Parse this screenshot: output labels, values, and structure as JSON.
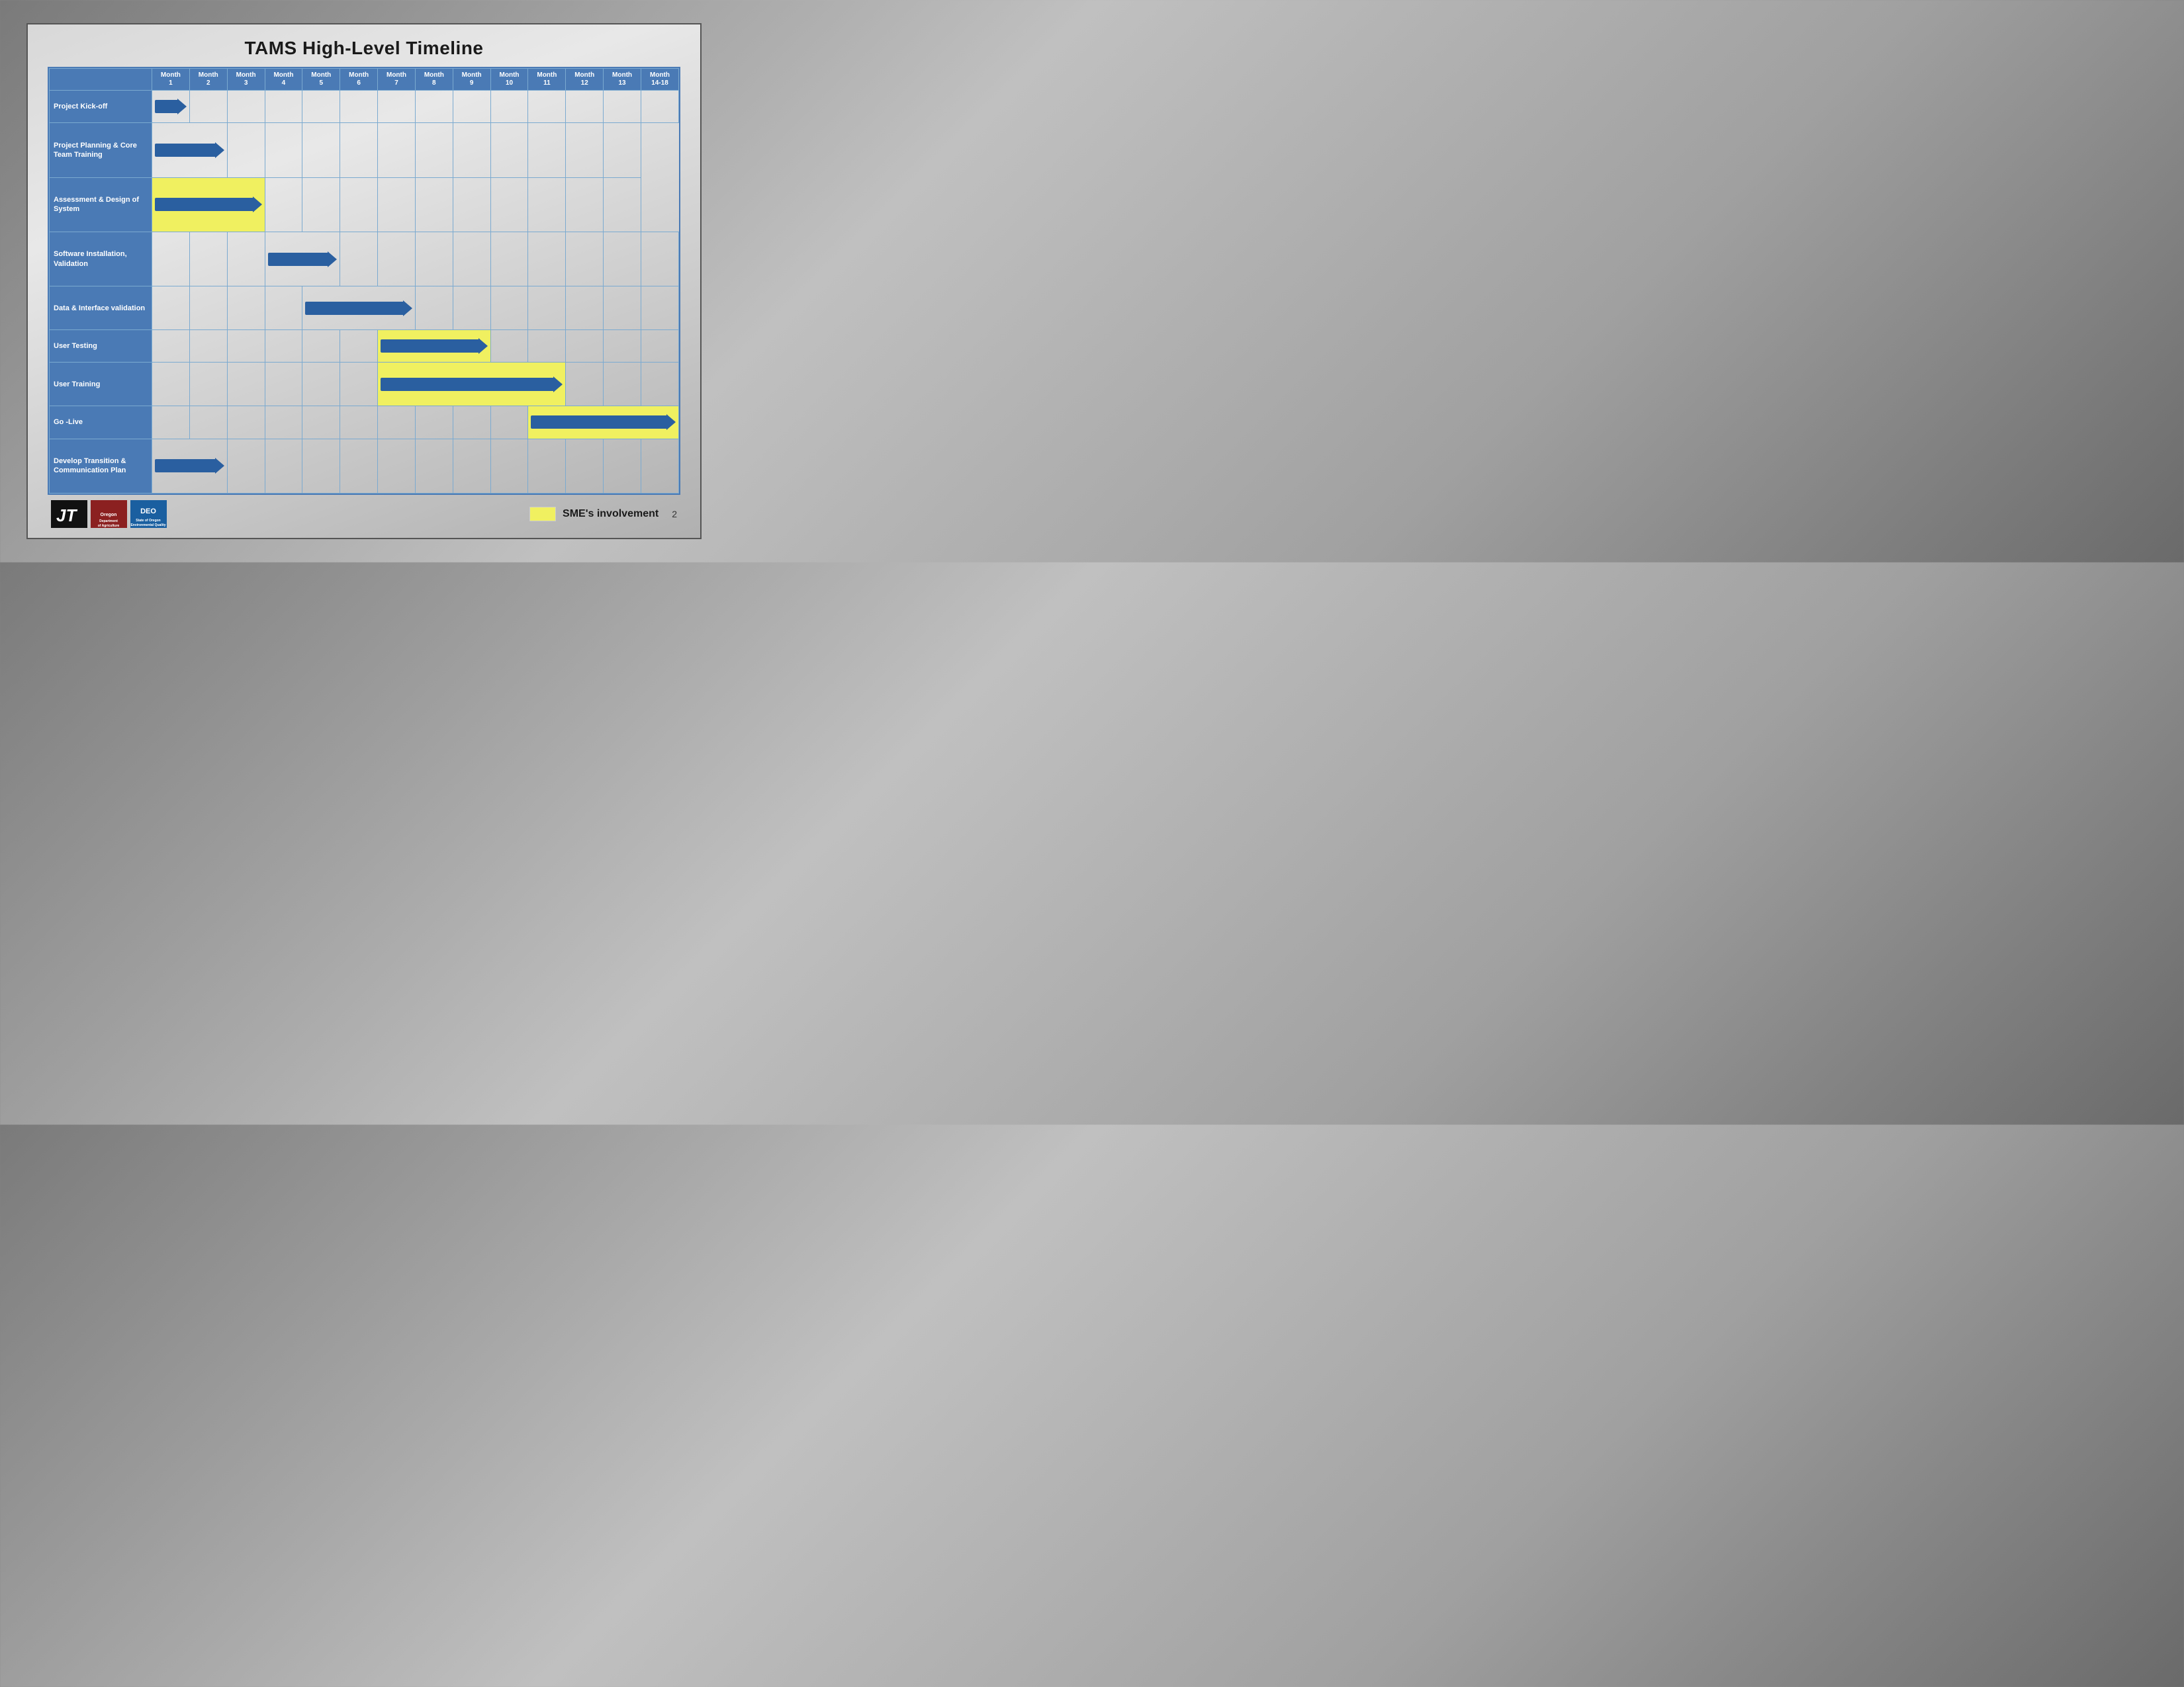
{
  "title": "TAMS High-Level Timeline",
  "months": [
    {
      "label": "Month",
      "sub": "1"
    },
    {
      "label": "Month",
      "sub": "2"
    },
    {
      "label": "Month",
      "sub": "3"
    },
    {
      "label": "Month",
      "sub": "4"
    },
    {
      "label": "Month",
      "sub": "5"
    },
    {
      "label": "Month",
      "sub": "6"
    },
    {
      "label": "Month",
      "sub": "7"
    },
    {
      "label": "Month",
      "sub": "8"
    },
    {
      "label": "Month",
      "sub": "9"
    },
    {
      "label": "Month",
      "sub": "10"
    },
    {
      "label": "Month",
      "sub": "11"
    },
    {
      "label": "Month",
      "sub": "12"
    },
    {
      "label": "Month",
      "sub": "13"
    },
    {
      "label": "Month",
      "sub": "14-18"
    }
  ],
  "tasks": [
    {
      "name": "Project Kick-off",
      "arrow_start": 1,
      "arrow_end": 1,
      "yellow": false
    },
    {
      "name": "Project Planning & Core Team Training",
      "arrow_start": 1,
      "arrow_end": 2,
      "yellow": false
    },
    {
      "name": "Assessment & Design of System",
      "arrow_start": 1,
      "arrow_end": 3,
      "yellow": true
    },
    {
      "name": "Software Installation, Validation",
      "arrow_start": 4,
      "arrow_end": 5,
      "yellow": false
    },
    {
      "name": "Data & Interface validation",
      "arrow_start": 5,
      "arrow_end": 7,
      "yellow": false
    },
    {
      "name": "User Testing",
      "arrow_start": 7,
      "arrow_end": 9,
      "yellow": true
    },
    {
      "name": "User Training",
      "arrow_start": 7,
      "arrow_end": 11,
      "yellow": true
    },
    {
      "name": "Go -Live",
      "arrow_start": 11,
      "arrow_end": 14,
      "yellow": true
    },
    {
      "name": "Develop Transition & Communication Plan",
      "arrow_start": 1,
      "arrow_end": 2,
      "yellow": false
    }
  ],
  "legend": {
    "label": "SME's involvement"
  },
  "slide_number": "2"
}
